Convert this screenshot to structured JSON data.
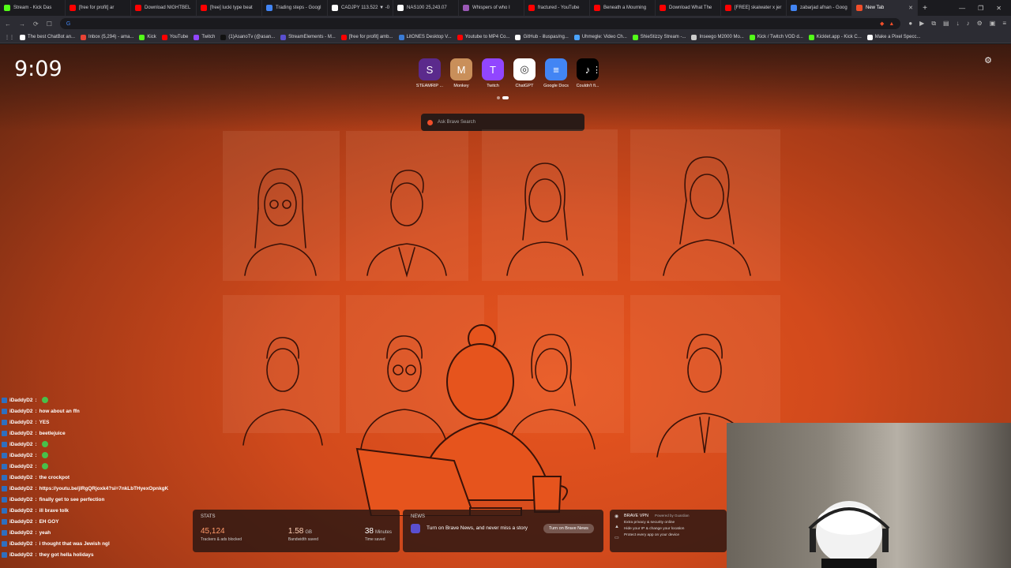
{
  "browser": {
    "tabs": [
      {
        "title": "Stream - Kick Das",
        "color": "#53fc18"
      },
      {
        "title": "[free for profit] ar",
        "color": "#ff0000"
      },
      {
        "title": "Download NIGHTBEL",
        "color": "#ff0000"
      },
      {
        "title": "[free] lucki type beat",
        "color": "#ff0000"
      },
      {
        "title": "Trading steps - Googl",
        "color": "#4285f4"
      },
      {
        "title": "CADJPY 113.522 ▼ -0",
        "color": "#ffffff"
      },
      {
        "title": "NAS100 25,243.07",
        "color": "#ffffff"
      },
      {
        "title": "Whispers of who I",
        "color": "#9b59b6"
      },
      {
        "title": "fractured - YouTube",
        "color": "#ff0000"
      },
      {
        "title": "Beneath a Mourning",
        "color": "#ff0000"
      },
      {
        "title": "Download What The",
        "color": "#ff0000"
      },
      {
        "title": "[FREE] skaiwater x jer",
        "color": "#ff0000"
      },
      {
        "title": "zabarjad afnan - Goog",
        "color": "#4285f4"
      },
      {
        "title": "New Tab",
        "color": "#f04e2a"
      }
    ],
    "bookmarks": [
      {
        "label": "The best ChatBot an...",
        "color": "#ffffff"
      },
      {
        "label": "Inbox (5,294) - ama...",
        "color": "#ea4335"
      },
      {
        "label": "Kick",
        "color": "#53fc18"
      },
      {
        "label": "YouTube",
        "color": "#ff0000"
      },
      {
        "label": "Twitch",
        "color": "#9146ff"
      },
      {
        "label": "(1)AsanoTv (@asan...",
        "color": "#111111"
      },
      {
        "label": "StreamElements - M...",
        "color": "#5a4fcf"
      },
      {
        "label": "[free for profit] amb...",
        "color": "#ff0000"
      },
      {
        "label": "LitONES Desktop V...",
        "color": "#3a7bd5"
      },
      {
        "label": "Youtube to MP4 Co...",
        "color": "#ff0000"
      },
      {
        "label": "GitHub - illuspas/ng...",
        "color": "#ffffff"
      },
      {
        "label": "Uhmegle: Video Ch...",
        "color": "#4aa3ff"
      },
      {
        "label": "ShieStizzy Stream -...",
        "color": "#53fc18"
      },
      {
        "label": "Inseego M2000 Mo...",
        "color": "#cccccc"
      },
      {
        "label": "Kick / Twitch VOD d...",
        "color": "#53fc18"
      },
      {
        "label": "Kicklet.app - Kick C...",
        "color": "#53fc18"
      },
      {
        "label": "Make a Pixel Specc...",
        "color": "#ffffff"
      }
    ]
  },
  "newtab": {
    "clock": "9:09",
    "topsites": [
      {
        "label": "STEAMRIP ...",
        "icon": "S"
      },
      {
        "label": "Monkey",
        "icon": "M"
      },
      {
        "label": "Twitch",
        "icon": "T"
      },
      {
        "label": "ChatGPT",
        "icon": "◎"
      },
      {
        "label": "Google Docs",
        "icon": "≡"
      },
      {
        "label": "Couldn't fi...",
        "icon": "♪"
      }
    ],
    "search_placeholder": "Ask Brave Search",
    "stats": {
      "title": "STATS",
      "trackers": "45,124",
      "trackers_label": "Trackers & ads blocked",
      "bandwidth": "1.58",
      "bandwidth_unit": "GB",
      "bandwidth_label": "Bandwidth saved",
      "time": "38",
      "time_unit": "Minutes",
      "time_label": "Time saved"
    },
    "news": {
      "title": "NEWS",
      "text": "Turn on Brave News, and never miss a story",
      "button": "Turn on Brave News"
    },
    "vpn": {
      "title": "BRAVE VPN",
      "powered": "Powered by Guardian",
      "features": [
        "Extra privacy & security online",
        "Hide your IP & change your location",
        "Protect every app on your device"
      ]
    }
  },
  "chat": [
    {
      "user": "iDaddyD2",
      "text": "",
      "emote": true
    },
    {
      "user": "iDaddyD2",
      "text": "how about an ffn",
      "emote": false
    },
    {
      "user": "iDaddyD2",
      "text": "YES",
      "emote": false
    },
    {
      "user": "iDaddyD2",
      "text": "beetlejuice",
      "emote": false
    },
    {
      "user": "iDaddyD2",
      "text": "",
      "emote": true
    },
    {
      "user": "iDaddyD2",
      "text": "",
      "emote": true
    },
    {
      "user": "iDaddyD2",
      "text": "",
      "emote": true
    },
    {
      "user": "iDaddyD2",
      "text": "the crockpot",
      "emote": false
    },
    {
      "user": "iDaddyD2",
      "text": "https://youtu.be/jlRgQRjoxk4?si=7nkLbTHyexOpnkgK",
      "emote": false
    },
    {
      "user": "iDaddyD2",
      "text": "finally get to see perfection",
      "emote": false
    },
    {
      "user": "iDaddyD2",
      "text": "ill brave tolk",
      "emote": false
    },
    {
      "user": "iDaddyD2",
      "text": "EH GOY",
      "emote": false
    },
    {
      "user": "iDaddyD2",
      "text": "yeah",
      "emote": false
    },
    {
      "user": "iDaddyD2",
      "text": "i thought that was Jewish ngl",
      "emote": false
    },
    {
      "user": "iDaddyD2",
      "text": "they got hella holidays",
      "emote": false
    }
  ]
}
